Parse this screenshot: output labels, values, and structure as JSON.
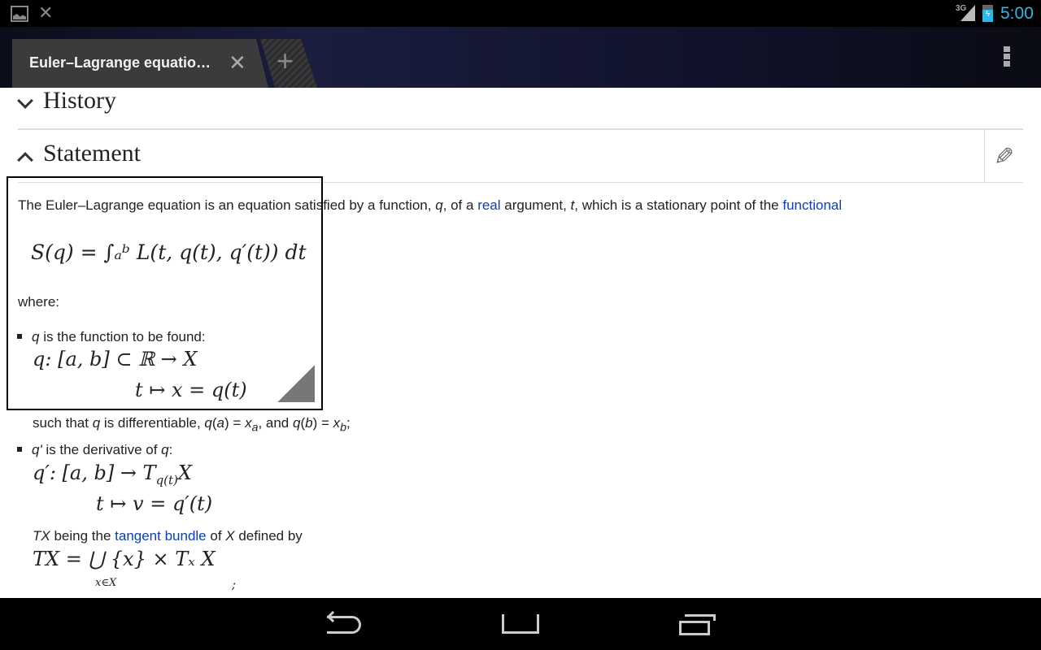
{
  "status_bar": {
    "network": "3G",
    "time": "5:00",
    "time_color": "#33b5e5",
    "icons": [
      "image-notification-icon",
      "close-notification-icon",
      "signal-icon",
      "battery-charging-icon"
    ]
  },
  "browser": {
    "tab_title": "Euler–Lagrange equatio…",
    "new_tab": "+",
    "menu": "overflow-menu-icon"
  },
  "sections": {
    "history": "History",
    "statement": "Statement"
  },
  "content": {
    "p1": [
      "The Euler–Lagrange equation is an equation satisfied by a function, ",
      "q",
      ", of a ",
      "real",
      " argument, ",
      "t",
      ", which is a stationary point of the ",
      "functional"
    ],
    "eq1": "S(q) = ∫ₐᵇ L(t, q(t), q′(t)) dt",
    "where": "where:",
    "b1": [
      "q",
      " is the function to be found:"
    ],
    "eq2a": "q: [a, b] ⊂ ℝ → X",
    "eq2b": "t ↦ x = q(t)",
    "b1_tail": [
      "such that ",
      "q",
      " is differentiable, ",
      "q",
      "(",
      "a",
      ") = ",
      "x",
      "a",
      ", and ",
      "q",
      "(",
      "b",
      ") = ",
      "x",
      "b",
      ";"
    ],
    "b2": [
      "q'",
      " is the derivative of ",
      "q",
      ":"
    ],
    "eq3a": "q′: [a, b] → T",
    "eq3a_sub": "q(t)",
    "eq3a_end": "X",
    "eq3b": "t ↦ v = q′(t)",
    "tx": [
      "TX",
      " being the ",
      "tangent bundle",
      " of ",
      "X",
      " defined by"
    ],
    "eq4": "TX = ⋃ {x} × Tₓ X",
    "eq4_sub": "x∈X",
    "eq4_end": ";"
  },
  "colors": {
    "link": "#0b3fb3",
    "text": "#222222"
  }
}
